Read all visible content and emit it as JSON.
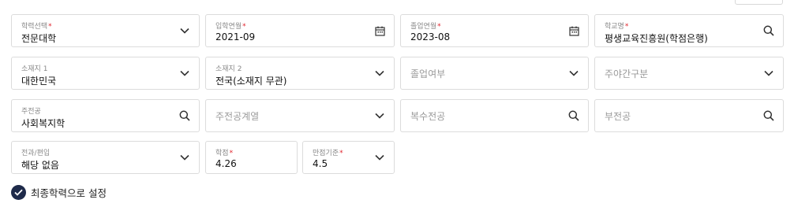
{
  "form": {
    "row1": [
      {
        "label": "학력선택",
        "required": true,
        "value": "전문대학",
        "icon": "chevron-down-icon"
      },
      {
        "label": "입학연월",
        "required": true,
        "value": "2021-09",
        "icon": "calendar-icon"
      },
      {
        "label": "졸업연월",
        "required": true,
        "value": "2023-08",
        "icon": "calendar-icon"
      },
      {
        "label": "학교명",
        "required": true,
        "value": "평생교육진흥원(학점은행)",
        "icon": "search-icon"
      }
    ],
    "row2": [
      {
        "label": "소재지 1",
        "value": "대한민국",
        "icon": "chevron-down-icon"
      },
      {
        "label": "소재지 2",
        "value": "전국(소재지 무관)",
        "icon": "chevron-down-icon"
      },
      {
        "placeholder": "졸업여부",
        "icon": "chevron-down-icon"
      },
      {
        "placeholder": "주야간구분",
        "icon": "chevron-down-icon"
      }
    ],
    "row3": [
      {
        "label": "주전공",
        "value": "사회복지학",
        "icon": "search-icon"
      },
      {
        "placeholder": "주전공계열",
        "icon": "chevron-down-icon"
      },
      {
        "placeholder": "복수전공",
        "icon": "search-icon"
      },
      {
        "placeholder": "부전공",
        "icon": "search-icon"
      }
    ],
    "row4": [
      {
        "label": "전과/편입",
        "value": "해당 없음",
        "icon": "chevron-down-icon"
      },
      {
        "label": "학점",
        "required": true,
        "value": "4.26"
      },
      {
        "label": "만점기준",
        "required": true,
        "value": "4.5",
        "icon": "chevron-down-icon"
      }
    ],
    "required_mark": "*"
  },
  "final_education": {
    "label": "최종학력으로 설정",
    "checked": true
  },
  "colors": {
    "accent": "#1e2a4a",
    "required": "#e0242c",
    "border": "#dcdcdc"
  }
}
